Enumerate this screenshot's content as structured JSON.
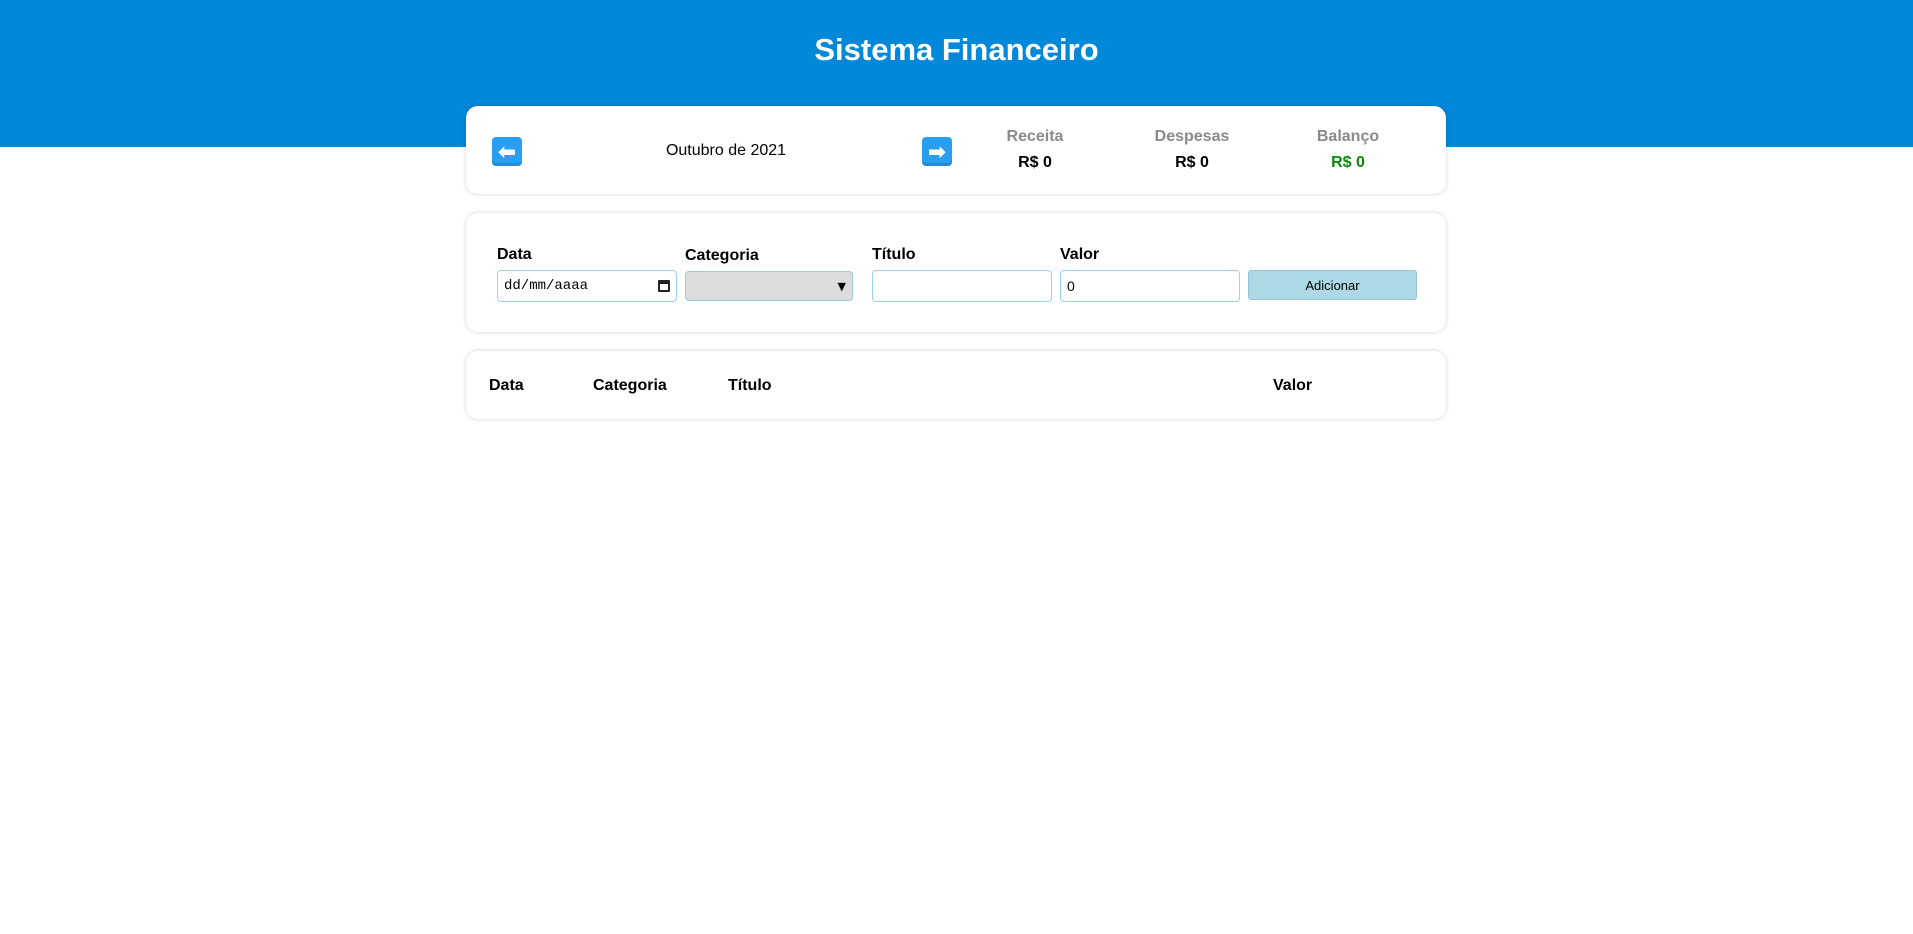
{
  "header": {
    "title": "Sistema Financeiro"
  },
  "info": {
    "prev_icon": "left-arrow-icon",
    "next_icon": "right-arrow-icon",
    "prev_glyph": "⬅",
    "next_glyph": "➡",
    "month": "Outubro de 2021",
    "summary": {
      "receita": {
        "label": "Receita",
        "value": "R$ 0"
      },
      "despesas": {
        "label": "Despesas",
        "value": "R$ 0"
      },
      "balanco": {
        "label": "Balanço",
        "value": "R$ 0",
        "color": "#0a8a0a"
      }
    }
  },
  "form": {
    "data": {
      "label": "Data",
      "placeholder": "dd/mm/aaaa"
    },
    "categoria": {
      "label": "Categoria",
      "selected": ""
    },
    "titulo": {
      "label": "Título",
      "value": ""
    },
    "valor": {
      "label": "Valor",
      "value": "0"
    },
    "add_label": "Adicionar"
  },
  "table": {
    "headers": [
      "Data",
      "Categoria",
      "Título",
      "Valor"
    ],
    "rows": []
  },
  "colors": {
    "header_bg": "#0288d9",
    "button_bg": "#add8e6",
    "positive": "#0a8a0a"
  }
}
